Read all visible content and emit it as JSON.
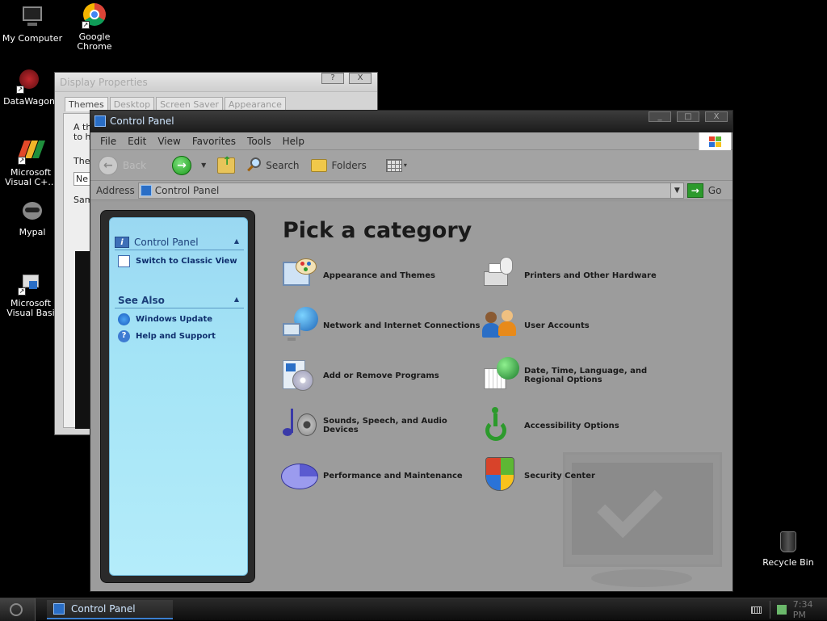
{
  "desktop": {
    "icons": [
      {
        "label": "My Computer"
      },
      {
        "label": "Google Chrome"
      },
      {
        "label": "DataWagon"
      },
      {
        "label": "Microsoft Visual C+..."
      },
      {
        "label": "Mypal"
      },
      {
        "label": "Microsoft Visual Basi"
      }
    ],
    "recycle_bin": "Recycle Bin"
  },
  "display_properties": {
    "title": "Display Properties",
    "tabs": [
      "Themes",
      "Desktop",
      "Screen Saver",
      "Appearance"
    ],
    "lines": [
      "A th",
      "to h",
      "The",
      "Ne",
      "Sam"
    ],
    "buttons": [
      "?",
      "X"
    ]
  },
  "control_panel": {
    "title": "Control Panel",
    "window_buttons": [
      "_",
      "□",
      "X"
    ],
    "menu": [
      "File",
      "Edit",
      "View",
      "Favorites",
      "Tools",
      "Help"
    ],
    "toolbar": {
      "back": "Back",
      "search": "Search",
      "folders": "Folders"
    },
    "address": {
      "label": "Address",
      "value": "Control Panel",
      "go": "Go"
    },
    "taskpane": {
      "section_title": "Control Panel",
      "switch_link": "Switch to Classic View",
      "see_also_title": "See Also",
      "see_also_links": [
        "Windows Update",
        "Help and Support"
      ]
    },
    "heading": "Pick a category",
    "categories": [
      {
        "label": "Appearance and Themes",
        "icon": "appearance-icon"
      },
      {
        "label": "Printers and Other Hardware",
        "icon": "printer-icon"
      },
      {
        "label": "Network and Internet Connections",
        "icon": "network-icon"
      },
      {
        "label": "User Accounts",
        "icon": "users-icon"
      },
      {
        "label": "Add or Remove Programs",
        "icon": "programs-icon"
      },
      {
        "label": "Date, Time, Language, and Regional Options",
        "icon": "date-time-icon"
      },
      {
        "label": "Sounds, Speech, and Audio Devices",
        "icon": "sound-icon"
      },
      {
        "label": "Accessibility Options",
        "icon": "accessibility-icon"
      },
      {
        "label": "Performance and Maintenance",
        "icon": "performance-icon"
      },
      {
        "label": "Security Center",
        "icon": "shield-icon"
      }
    ]
  },
  "taskbar": {
    "task_label": "Control Panel",
    "clock": "7:34 PM"
  }
}
